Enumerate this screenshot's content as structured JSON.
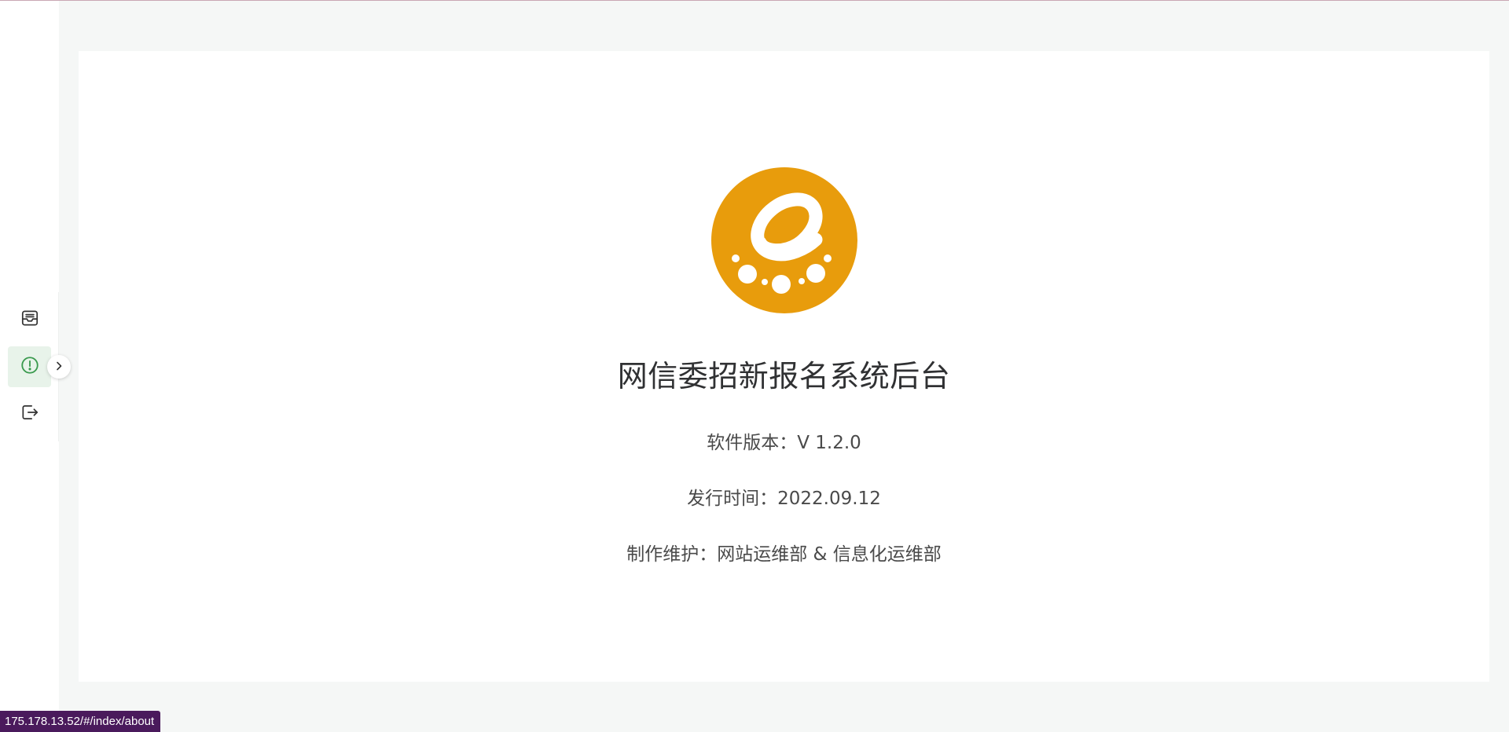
{
  "sidebar": {
    "items": [
      {
        "icon": "inbox-icon",
        "active": false
      },
      {
        "icon": "info-icon",
        "active": true
      },
      {
        "icon": "logout-icon",
        "active": false
      }
    ],
    "expand_icon": "chevron-right-icon"
  },
  "about": {
    "logo_icon": "e-logo",
    "title": "网信委招新报名系统后台",
    "version": "软件版本：V 1.2.0",
    "release": "发行时间：2022.09.12",
    "maintainer": "制作维护：网站运维部 & 信息化运维部"
  },
  "status_bar": {
    "url": "175.178.13.52/#/index/about"
  },
  "colors": {
    "accent_green": "#3a9a4e",
    "logo_orange": "#e89c0c",
    "page_bg": "#f5f7f6"
  }
}
